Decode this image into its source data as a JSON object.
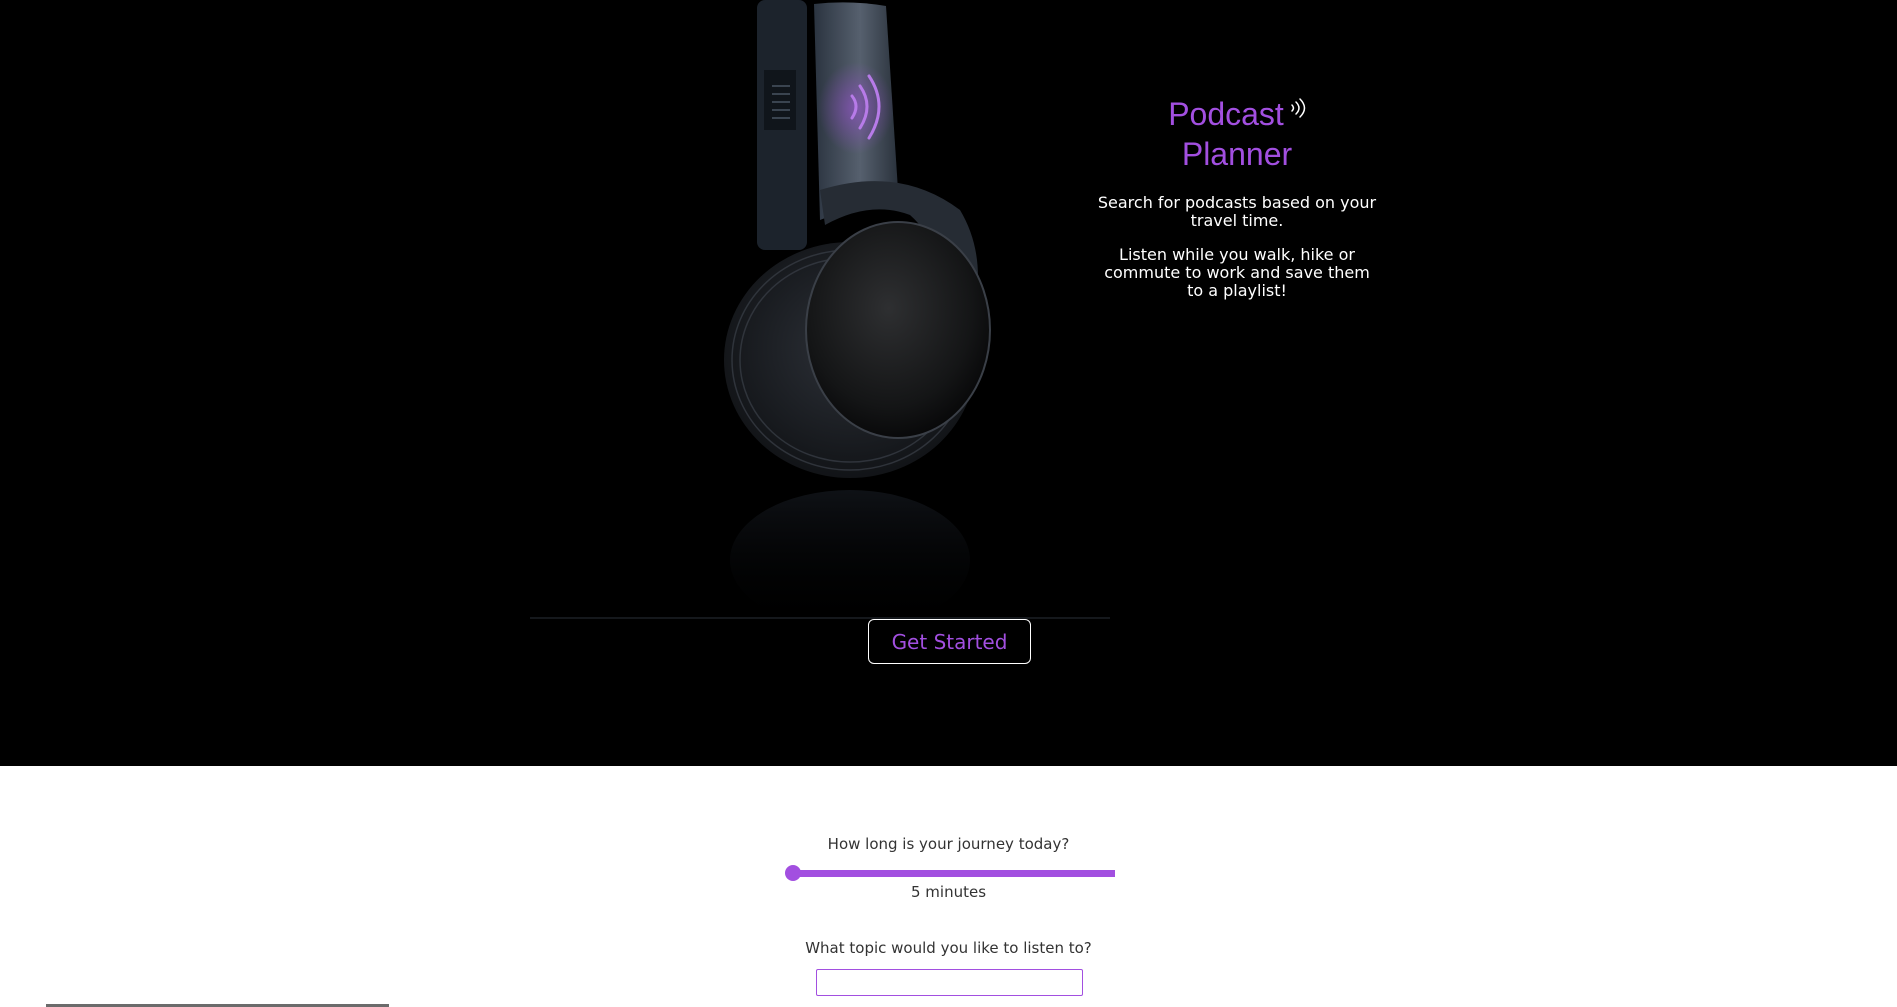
{
  "hero": {
    "title_line1": "Podcast",
    "title_line2": "Planner",
    "description_1": "Search for podcasts based on your travel time.",
    "description_2": "Listen while you walk, hike or commute to work and save them to a playlist!",
    "cta_label": "Get Started"
  },
  "journey": {
    "question": "How long is your journey today?",
    "slider_value_fraction": 0,
    "duration_text": "5 minutes"
  },
  "topic": {
    "question": "What topic would you like to listen to?",
    "input_value": "",
    "input_placeholder": ""
  },
  "icons": {
    "title_icon": "sound-waves-icon",
    "image": "headphones-image"
  },
  "colors": {
    "accent": "#a24fe0",
    "hero_background": "#000000",
    "page_background": "#ffffff",
    "body_text": "#333333"
  }
}
